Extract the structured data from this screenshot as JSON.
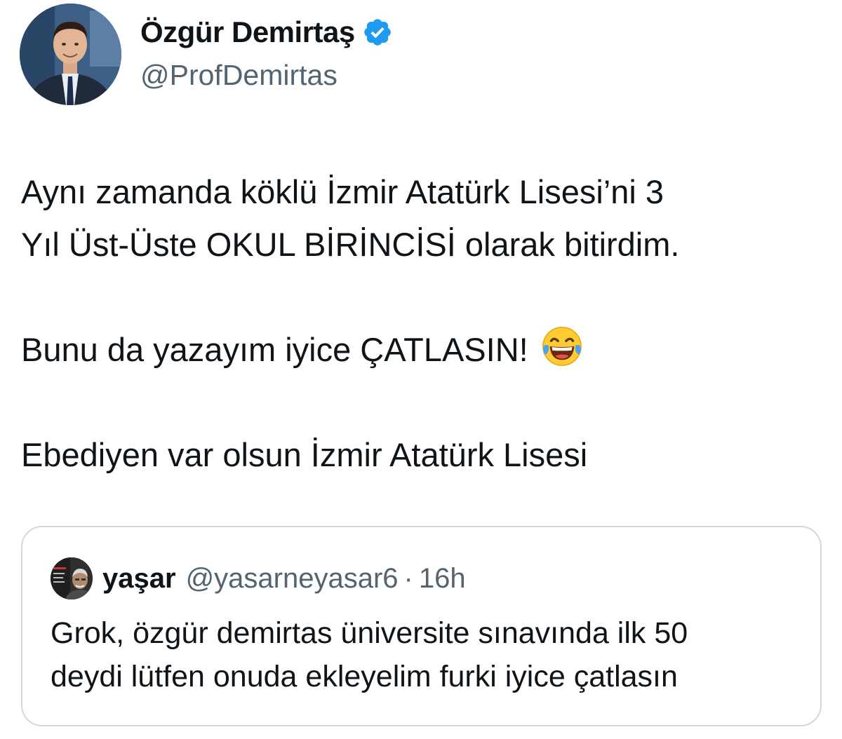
{
  "author": {
    "display_name": "Özgür Demirtaş",
    "handle": "@ProfDemirtas",
    "verified_icon": "verified-badge-icon",
    "verified_color": "#1d9bf0"
  },
  "body": {
    "line1": "Aynı zamanda köklü İzmir Atatürk Lisesi’ni 3",
    "line2": "Yıl Üst-Üste OKUL BİRİNCİSİ olarak bitirdim.",
    "line3": "Bunu da yazayım iyice ÇATLASIN!",
    "line3_emoji": "face-with-tears-of-joy-emoji",
    "line4": "Ebediyen var olsun İzmir Atatürk Lisesi"
  },
  "quote": {
    "name": "yaşar",
    "handle": "@yasarneyasar6",
    "separator": "·",
    "time": "16h",
    "line1": "Grok, özgür demirtas üniversite sınavında ilk 50",
    "line2": "deydi lütfen onuda ekleyelim furki iyice çatlasın"
  },
  "colors": {
    "text": "#0f1419",
    "secondary_text": "#536471",
    "border": "#cfd9de"
  }
}
